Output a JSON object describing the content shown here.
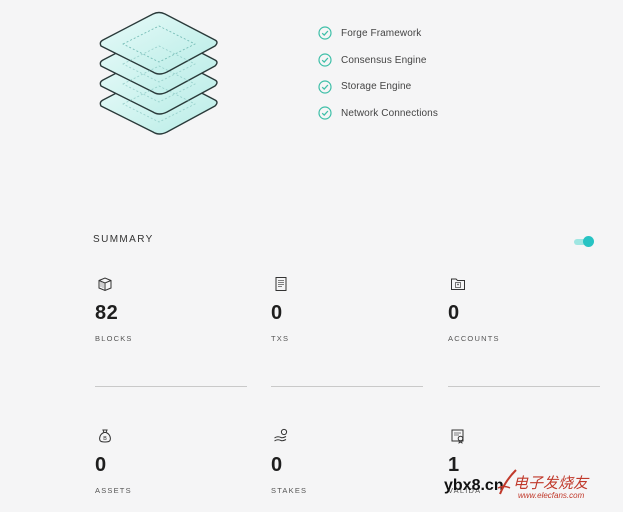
{
  "checklist": [
    {
      "label": "Forge Framework",
      "icon": "check-circle-icon"
    },
    {
      "label": "Consensus Engine",
      "icon": "check-circle-icon"
    },
    {
      "label": "Storage Engine",
      "icon": "check-circle-icon"
    },
    {
      "label": "Network Connections",
      "icon": "check-circle-icon"
    }
  ],
  "summary": {
    "title": "SUMMARY",
    "toggle_on": true,
    "stats": [
      {
        "value": "82",
        "label": "BLOCKS",
        "icon": "cube-icon"
      },
      {
        "value": "0",
        "label": "TXS",
        "icon": "receipt-icon"
      },
      {
        "value": "0",
        "label": "ACCOUNTS",
        "icon": "folder-user-icon"
      },
      {
        "value": "0",
        "label": "ASSETS",
        "icon": "money-bag-icon"
      },
      {
        "value": "0",
        "label": "STAKES",
        "icon": "hand-coin-icon"
      },
      {
        "value": "1",
        "label": "VALIDA",
        "icon": "certificate-icon"
      }
    ]
  },
  "colors": {
    "accent": "#27c3c3",
    "check": "#3ebfa8",
    "illustration_fill": "#d6f4f1",
    "watermark_red": "#c0392b"
  },
  "watermark": {
    "left_text": "ybx8.cn",
    "right_text": "电子发烧友",
    "url": "www.elecfans.com"
  }
}
